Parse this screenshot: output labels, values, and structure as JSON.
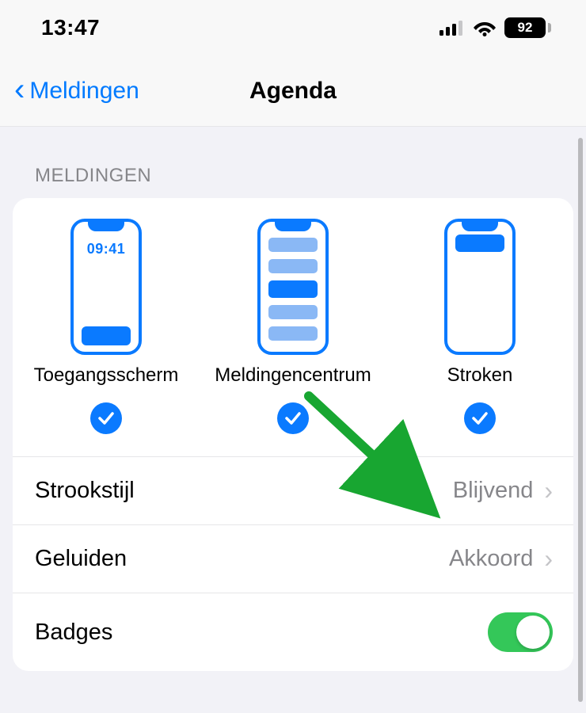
{
  "status": {
    "time": "13:47",
    "battery_pct": "92"
  },
  "nav": {
    "back_label": "Meldingen",
    "title": "Agenda"
  },
  "section_header": "MELDINGEN",
  "options": {
    "lock": {
      "label": "Toegangsscherm",
      "preview_time": "09:41",
      "checked": true
    },
    "center": {
      "label": "Meldingencentrum",
      "checked": true
    },
    "banners": {
      "label": "Stroken",
      "checked": true
    }
  },
  "rows": {
    "banner_style": {
      "label": "Strookstijl",
      "value": "Blijvend"
    },
    "sounds": {
      "label": "Geluiden",
      "value": "Akkoord"
    },
    "badges": {
      "label": "Badges",
      "on": true
    }
  }
}
